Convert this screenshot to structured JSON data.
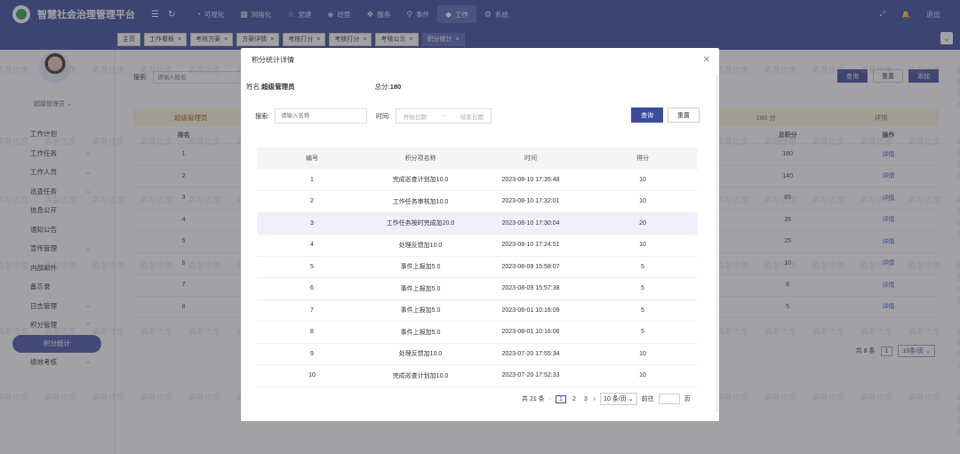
{
  "app": {
    "title": "智慧社会治理管理平台"
  },
  "topnav": [
    {
      "label": "可视化",
      "icon": "gauge-icon"
    },
    {
      "label": "网格化",
      "icon": "grid-icon"
    },
    {
      "label": "党建",
      "icon": "star-icon"
    },
    {
      "label": "经营",
      "icon": "diamond-icon"
    },
    {
      "label": "服务",
      "icon": "service-icon"
    },
    {
      "label": "事件",
      "icon": "pin-icon"
    },
    {
      "label": "工作",
      "icon": "work-icon"
    },
    {
      "label": "系统",
      "icon": "gear-icon"
    }
  ],
  "topright": {
    "logout": "退出"
  },
  "tabs": [
    {
      "label": "主页",
      "closable": false
    },
    {
      "label": "工作看板",
      "closable": true
    },
    {
      "label": "考核方案",
      "closable": true
    },
    {
      "label": "方案详情",
      "closable": true
    },
    {
      "label": "考核打分",
      "closable": true
    },
    {
      "label": "考核打分",
      "closable": true
    },
    {
      "label": "考核公示",
      "closable": true
    },
    {
      "label": "积分统计",
      "closable": true
    }
  ],
  "sidebar": {
    "user": "超级管理员",
    "items": [
      {
        "label": "工作计划",
        "chev": ""
      },
      {
        "label": "工作任务",
        "chev": "⌄"
      },
      {
        "label": "工作人员",
        "chev": "⌄"
      },
      {
        "label": "巡查任务",
        "chev": "⌄"
      },
      {
        "label": "信息公开",
        "chev": ""
      },
      {
        "label": "通知公告",
        "chev": ""
      },
      {
        "label": "宣传管理",
        "chev": "⌄"
      },
      {
        "label": "内部邮件",
        "chev": ""
      },
      {
        "label": "备忘录",
        "chev": ""
      },
      {
        "label": "日志管理",
        "chev": "⌄"
      },
      {
        "label": "积分管理",
        "chev": "⌃"
      }
    ],
    "sub_active": "积分统计",
    "after": {
      "label": "绩效考核",
      "chev": "⌄"
    }
  },
  "main": {
    "search_label": "搜索:",
    "search_placeholder": "请输入姓名",
    "query": "查询",
    "reset": "重置",
    "add": "添加",
    "summary": {
      "left": "超级管理员",
      "mid": "180 分",
      "right": "详情"
    },
    "headers": [
      "排名",
      "",
      "",
      "",
      "",
      "",
      "总积分",
      "操作"
    ],
    "rows": [
      {
        "rank": "1",
        "total": "180",
        "op": "详情"
      },
      {
        "rank": "2",
        "total": "140",
        "op": "详情"
      },
      {
        "rank": "3",
        "total": "65",
        "op": "详情"
      },
      {
        "rank": "4",
        "total": "35",
        "op": "详情"
      },
      {
        "rank": "5",
        "total": "25",
        "op": "详情"
      },
      {
        "rank": "6",
        "total": "10",
        "op": "详情"
      },
      {
        "rank": "7",
        "total": "8",
        "op": "详情"
      },
      {
        "rank": "8",
        "total": "5",
        "op": "详情"
      }
    ],
    "pager": {
      "total": "共 8 条",
      "page": "1",
      "size": "10条/页"
    }
  },
  "modal": {
    "title": "积分统计详情",
    "name_label": "姓名:",
    "name": "超级管理员",
    "total_label": "总分:",
    "total": "180",
    "search_label": "搜索:",
    "search_placeholder": "请输入名称",
    "time_label": "时间:",
    "start_placeholder": "开始日期",
    "range_sep": "~",
    "end_placeholder": "结束日期",
    "query": "查询",
    "reset": "重置",
    "headers": [
      "编号",
      "积分项名称",
      "时间",
      "得分"
    ],
    "rows": [
      {
        "no": "1",
        "name": "完成巡查计划加10.0",
        "time": "2023-08-10 17:35:48",
        "score": "10"
      },
      {
        "no": "2",
        "name": "工作任务审核加10.0",
        "time": "2023-08-10 17:32:01",
        "score": "10"
      },
      {
        "no": "3",
        "name": "工作任务按时完成加20.0",
        "time": "2023-08-10 17:30:04",
        "score": "20"
      },
      {
        "no": "4",
        "name": "处理反馈加10.0",
        "time": "2023-08-10 17:24:51",
        "score": "10"
      },
      {
        "no": "5",
        "name": "事件上报加5.0",
        "time": "2023-08-09 15:58:07",
        "score": "5"
      },
      {
        "no": "6",
        "name": "事件上报加5.0",
        "time": "2023-08-09 15:57:38",
        "score": "5"
      },
      {
        "no": "7",
        "name": "事件上报加5.0",
        "time": "2023-08-01 10:16:09",
        "score": "5"
      },
      {
        "no": "8",
        "name": "事件上报加5.0",
        "time": "2023-08-01 10:16:06",
        "score": "5"
      },
      {
        "no": "9",
        "name": "处理反馈加10.0",
        "time": "2023-07-20 17:55:34",
        "score": "10"
      },
      {
        "no": "10",
        "name": "完成巡查计划加10.0",
        "time": "2023-07-20 17:52:33",
        "score": "10"
      }
    ],
    "pager": {
      "total": "共 21 条",
      "pages": [
        "1",
        "2",
        "3"
      ],
      "size": "10 条/页",
      "goto": "前往",
      "unit": "页"
    }
  },
  "watermark": "森普信息",
  "colors": {
    "primary": "#3c4b9c",
    "link": "#4a57c8",
    "summary_bg": "#fdf5d8"
  }
}
